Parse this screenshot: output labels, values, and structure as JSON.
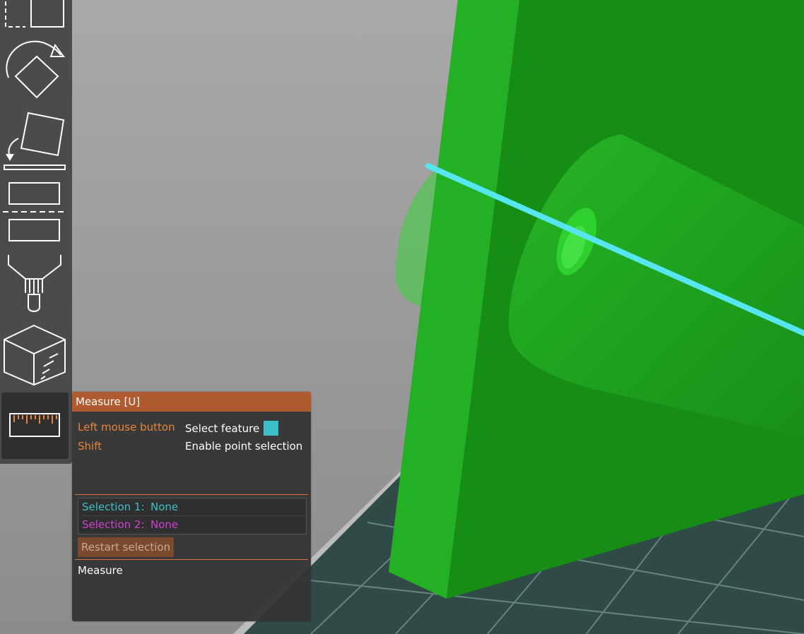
{
  "colors": {
    "accent": "#e8843c",
    "title_bar": "#b05a30",
    "selection1": "#3cc0c8",
    "selection2": "#d040d0",
    "model": "#1fa51f",
    "measure_line": "#55e6f0"
  },
  "toolbar": {
    "tools": [
      {
        "icon": "cut-icon"
      },
      {
        "icon": "rotate-icon"
      },
      {
        "icon": "place-on-face-icon"
      },
      {
        "icon": "split-icon"
      },
      {
        "icon": "paint-brush-icon"
      },
      {
        "icon": "fdm-supports-cube-icon"
      },
      {
        "icon": "measure-ruler-icon",
        "active": true
      }
    ]
  },
  "panel": {
    "title": "Measure [U]",
    "shortcuts": [
      {
        "key": "Left mouse button",
        "action": "Select feature"
      },
      {
        "key": "Shift",
        "action": "Enable point selection"
      }
    ],
    "selection1": {
      "label": "Selection 1:",
      "value": "None"
    },
    "selection2": {
      "label": "Selection 2:",
      "value": "None"
    },
    "restart_label": "Restart selection",
    "measure_label": "Measure"
  }
}
